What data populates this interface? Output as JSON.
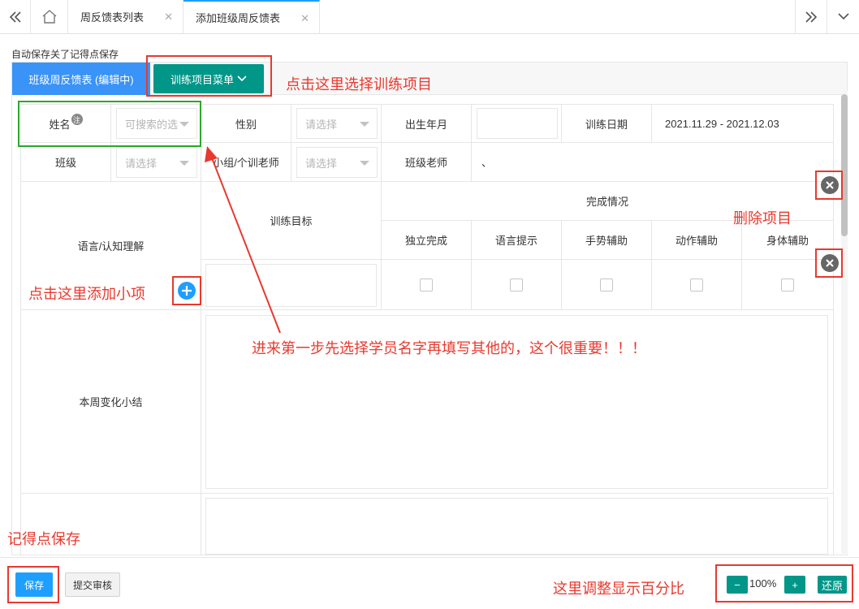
{
  "tabs": {
    "home_label": "",
    "items": [
      {
        "label": "周反馈表列表",
        "closable": true
      },
      {
        "label": "添加班级周反馈表",
        "closable": true
      }
    ]
  },
  "autosave_text": "自动保存关了记得点保存",
  "card": {
    "mode_title": "班级周反馈表 (编辑中)",
    "menu_button": "训练项目菜单"
  },
  "form": {
    "name_label": "姓名",
    "name_note": "注",
    "name_placeholder": "可搜索的选",
    "gender_label": "性别",
    "gender_placeholder": "请选择",
    "birth_label": "出生年月",
    "train_date_label": "训练日期",
    "train_date_value": "2021.11.29 - 2021.12.03",
    "class_label": "班级",
    "class_placeholder": "请选择",
    "group_teacher_label": "小组/个训老师",
    "group_teacher_placeholder": "请选择",
    "class_teacher_label": "班级老师",
    "class_teacher_value": "、"
  },
  "section": {
    "name": "语言/认知理解",
    "goal_header": "训练目标",
    "completion_header": "完成情况",
    "completion_columns": [
      "独立完成",
      "语言提示",
      "手势辅助",
      "动作辅助",
      "身体辅助"
    ],
    "summary_label": "本周变化小结"
  },
  "footer": {
    "save_label": "保存",
    "submit_label": "提交审核",
    "zoom_minus": "−",
    "zoom_value": "100%",
    "zoom_plus": "+",
    "zoom_reset": "还原"
  },
  "annotations": {
    "select_project": "点击这里选择训练项目",
    "delete_item": "删除项目",
    "add_subitem": "点击这里添加小项",
    "first_step": "进来第一步先选择学员名字再填写其他的，这个很重要！！！",
    "remember_save": "记得点保存",
    "adjust_zoom": "这里调整显示百分比"
  },
  "colors": {
    "primary_blue": "#1e9fff",
    "teal": "#009688",
    "annotation_red": "#e8392e",
    "annotation_green": "#2aa82a"
  }
}
